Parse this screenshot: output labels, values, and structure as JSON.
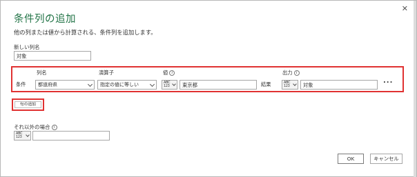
{
  "dialog": {
    "title": "条件列の追加",
    "description": "他の列または値から計算される、条件列を追加します。",
    "close_glyph": "✕"
  },
  "new_column": {
    "label": "新しい列名",
    "value": "対象"
  },
  "condition": {
    "headers": {
      "column": "列名",
      "operator": "演算子",
      "value": "値",
      "output": "出力"
    },
    "row_label": "条件",
    "column_selected": "都道府県",
    "operator_selected": "指定の値に等しい",
    "value_type_top": "ABC",
    "value_type_bottom": "123",
    "value_text": "東京都",
    "result_label": "結果",
    "output_type_top": "ABC",
    "output_type_bottom": "123",
    "output_text": "対象",
    "more_glyph": "..."
  },
  "add_clause_label": "句の追加",
  "otherwise": {
    "label": "それ以外の場合",
    "type_top": "ABC",
    "type_bottom": "123",
    "value": ""
  },
  "buttons": {
    "ok": "OK",
    "cancel": "キャンセル"
  },
  "icons": {
    "info": "i"
  },
  "colors": {
    "title": "#217346",
    "highlight": "#e03131"
  }
}
